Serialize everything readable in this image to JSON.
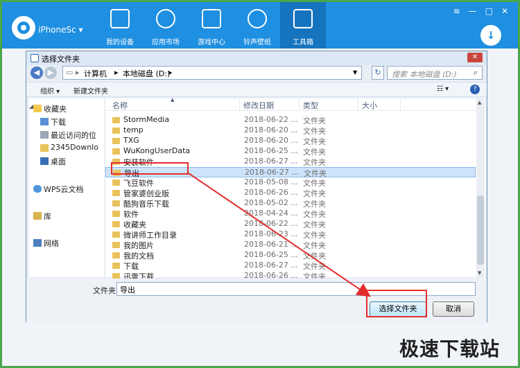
{
  "app": {
    "device_label": "iPhoneSc ▾",
    "nav": [
      {
        "label": "我的设备",
        "icon": "phone-icon"
      },
      {
        "label": "应用市场",
        "icon": "apps-icon"
      },
      {
        "label": "游戏中心",
        "icon": "gamepad-icon"
      },
      {
        "label": "铃声壁纸",
        "icon": "bell-icon"
      },
      {
        "label": "工具箱",
        "icon": "toolbox-icon"
      }
    ],
    "window_buttons": [
      "≡",
      "—",
      "□",
      "✕"
    ],
    "download_icon": "↓"
  },
  "dialog": {
    "title": "选择文件夹",
    "close": "✕",
    "breadcrumb": [
      "计算机",
      "本地磁盘 (D:)"
    ],
    "search_placeholder": "搜索 本地磁盘 (D:)",
    "toolbar": {
      "organize": "组织 ▾",
      "new_folder": "新建文件夹"
    },
    "columns": {
      "name": "名称",
      "date": "修改日期",
      "type": "类型",
      "size": "大小"
    },
    "nav_items": [
      {
        "label": "收藏夹",
        "icon": "star-icon",
        "level": "top"
      },
      {
        "label": "下载",
        "icon": "download-folder-icon",
        "level": "child"
      },
      {
        "label": "最近访问的位",
        "icon": "recent-icon",
        "level": "child"
      },
      {
        "label": "2345Downlo",
        "icon": "folder-icon",
        "level": "child"
      },
      {
        "label": "桌面",
        "icon": "desktop-icon",
        "level": "child"
      },
      {
        "label": "WPS云文档",
        "icon": "cloud-icon",
        "level": "top"
      },
      {
        "label": "库",
        "icon": "library-icon",
        "level": "top"
      },
      {
        "label": "网络",
        "icon": "network-icon",
        "level": "top"
      }
    ],
    "files": [
      {
        "name": "StormMedia",
        "date": "2018-06-22 ...",
        "type": "文件夹"
      },
      {
        "name": "temp",
        "date": "2018-06-20 ...",
        "type": "文件夹"
      },
      {
        "name": "TXG",
        "date": "2018-06-20 ...",
        "type": "文件夹"
      },
      {
        "name": "WuKongUserData",
        "date": "2018-06-25 ...",
        "type": "文件夹"
      },
      {
        "name": "安装软件",
        "date": "2018-06-27 ...",
        "type": "文件夹"
      },
      {
        "name": "导出",
        "date": "2018-06-27 ...",
        "type": "文件夹",
        "selected": true
      },
      {
        "name": "飞豆软件",
        "date": "2018-05-08 ...",
        "type": "文件夹"
      },
      {
        "name": "管家婆创业版",
        "date": "2018-06-26 ...",
        "type": "文件夹"
      },
      {
        "name": "酷狗音乐下载",
        "date": "2018-05-02 ...",
        "type": "文件夹"
      },
      {
        "name": "软件",
        "date": "2018-04-24 ...",
        "type": "文件夹"
      },
      {
        "name": "收藏夹",
        "date": "2018-06-22 ...",
        "type": "文件夹"
      },
      {
        "name": "微讲师工作目录",
        "date": "2018-06-23 ...",
        "type": "文件夹"
      },
      {
        "name": "我的图片",
        "date": "2018-06-21 ...",
        "type": "文件夹"
      },
      {
        "name": "我的文档",
        "date": "2018-06-25 ...",
        "type": "文件夹"
      },
      {
        "name": "下载",
        "date": "2018-06-27 ...",
        "type": "文件夹"
      },
      {
        "name": "迅雷下载",
        "date": "2018-06-26 ...",
        "type": "文件夹"
      }
    ],
    "folder_label": "文件夹:",
    "folder_value": "导出",
    "select_button": "选择文件夹",
    "cancel_button": "取消"
  },
  "watermark": "极速下载站",
  "colors": {
    "app_blue": "#1e8fe1",
    "annotation_red": "#e42c2c",
    "frame_green": "#4aa64a"
  }
}
